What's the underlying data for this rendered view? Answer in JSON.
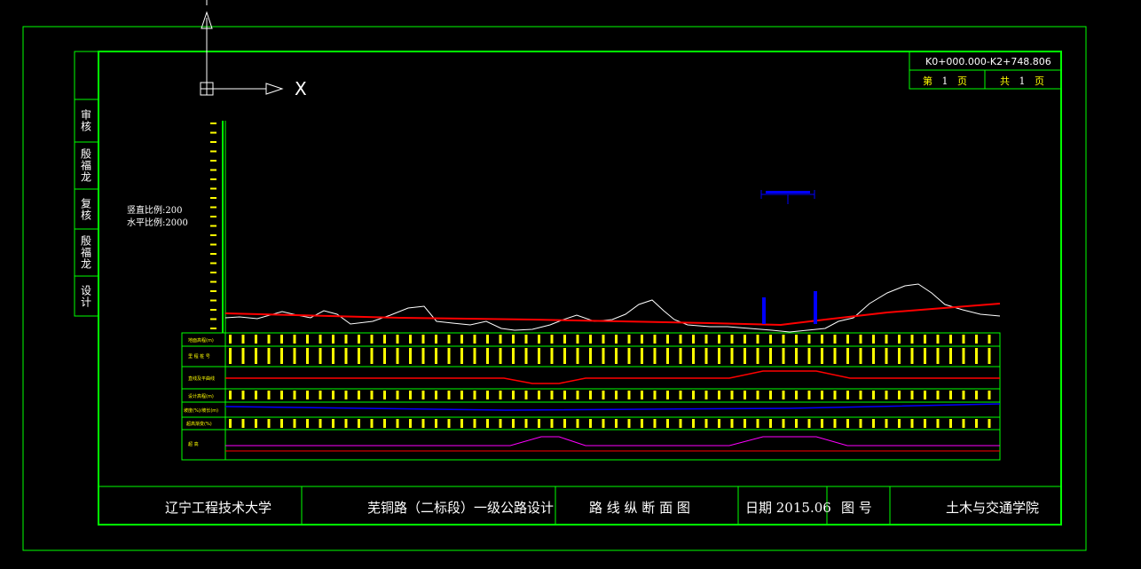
{
  "colors": {
    "frame": "#00ff00",
    "ground_line": "#ffffff",
    "design_line": "#ff0000",
    "label_yellow": "#ffff00",
    "blue": "#0000ff",
    "magenta": "#ff00ff"
  },
  "ucs": {
    "x_label": "X"
  },
  "range": {
    "stations": "K0+000.000-K2+748.806",
    "page_prefix": "第",
    "page_no": "1",
    "page_suffix": "页",
    "total_prefix": "共",
    "total_no": "1",
    "total_suffix": "页"
  },
  "side_block": [
    "审核",
    "殷福龙",
    "复核",
    "殷福龙",
    "设计"
  ],
  "scales": {
    "vertical": "竖直比例:200",
    "horizontal": "水平比例:2000"
  },
  "title_block": {
    "school": "辽宁工程技术大学",
    "project": "芜铜路（二标段）一级公路设计",
    "drawing_name": "路 线 纵 断 面 图",
    "date": "日期 2015.06",
    "drawing_no": "图  号",
    "college": "土木与交通学院"
  },
  "row_labels": [
    "地面高程(m)",
    "里 程 桩 号",
    "直线及平曲线",
    "设计高程(m)",
    "坡度(%)/坡长(m)",
    "超高渐变(%)",
    "超 高"
  ]
}
